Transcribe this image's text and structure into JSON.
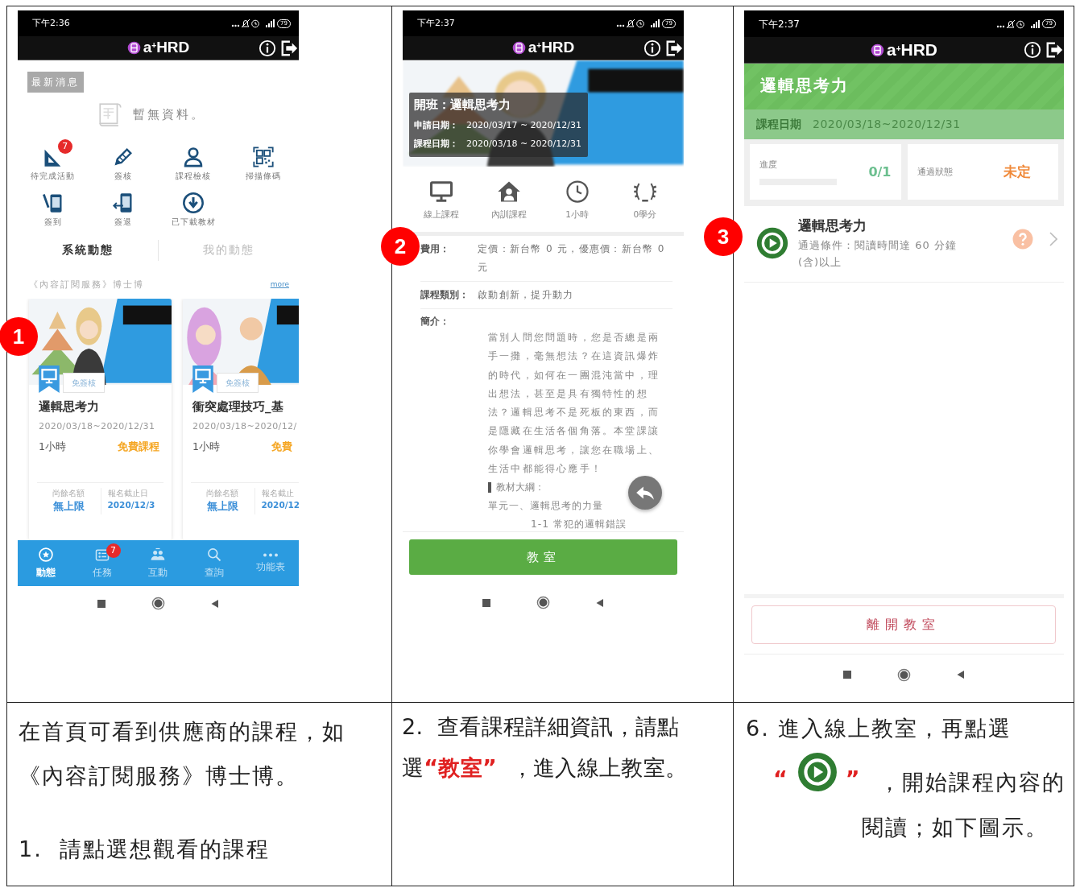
{
  "home_screen": {
    "status_bar": {
      "time": "下午2:36",
      "battery": "79"
    },
    "app_bar": {
      "brand": "a$^{+}$HRD"
    },
    "news_tab": "最新消息",
    "empty_message": "暫無資料。",
    "shortcuts": [
      {
        "label": "待完成活動",
        "badge": "7"
      },
      {
        "label": "簽核"
      },
      {
        "label": "課程檢核"
      },
      {
        "label": "掃描條碼"
      },
      {
        "label": "簽到"
      },
      {
        "label": "簽退"
      },
      {
        "label": "已下載教材"
      }
    ],
    "feed_tabs": [
      {
        "label": "系統動態",
        "selected": true
      },
      {
        "label": "我的動態",
        "selected": false
      }
    ],
    "section": {
      "title": "《內容訂閱服務》博士博",
      "link": "more"
    },
    "courses": [
      {
        "tag": "免簽核",
        "title": "邏輯思考力",
        "dates": "2020/03/18~2020/12/31",
        "duration": "1小時",
        "price": "免費課程",
        "quota_label": "尚餘名額",
        "quota": "無上限",
        "deadline_label": "報名截止日",
        "deadline": "2020/12/3"
      },
      {
        "tag": "免簽核",
        "title": "衝突處理技巧_基",
        "dates": "2020/03/18~2020/12/",
        "duration": "1小時",
        "price": "免費",
        "quota_label": "尚餘名額",
        "quota": "無上限",
        "deadline_label": "報名截止",
        "deadline": "2020/12"
      }
    ],
    "bottom_nav": [
      {
        "label": "動態",
        "selected": true
      },
      {
        "label": "任務",
        "selected": false,
        "badge": "7"
      },
      {
        "label": "互動",
        "selected": false
      },
      {
        "label": "查詢",
        "selected": false
      },
      {
        "label": "功能表",
        "selected": false
      }
    ],
    "step_marker": "1",
    "caption": {
      "paragraph": "在首頁可看到供應商的課程，如《內容訂閱服務》博士博。",
      "step": "1.  請點選想觀看的課程"
    }
  },
  "course_detail_screen": {
    "status_bar": {
      "time": "下午2:37",
      "battery": "79"
    },
    "app_bar": {
      "brand": "a$^{+}$HRD"
    },
    "banner": {
      "title": "開班：邏輯思考力",
      "dates": [
        {
          "label": "申請日期：",
          "value": "2020/03/17 ~ 2020/12/31"
        },
        {
          "label": "課程日期：",
          "value": "2020/03/18 ~ 2020/12/31"
        }
      ]
    },
    "facts": [
      "線上課程",
      "內訓課程",
      "1小時",
      "0學分"
    ],
    "fields": [
      {
        "label": "費用：",
        "value": "定價：新台幣 0 元，優惠價：新台幣 0 元"
      },
      {
        "label": "課程類別：",
        "value": "啟動創新，提升動力"
      }
    ],
    "intro": {
      "label": "簡介：",
      "paragraph": "當別人問您問題時，您是否總是兩手一攤，毫無想法？在這資訊爆炸的時代，如何在一團混沌當中，理出想法，甚至是具有獨特性的想法？邏輯思考不是死板的東西，而是隱藏在生活各個角落。本堂課讓你學會邏輯思考，讓您在職場上、生活中都能得心應手！",
      "outline_label": "教材大綱：",
      "unit": "單元一、邏輯思考的力量",
      "lesson": "1-1 常犯的邏輯錯誤"
    },
    "button": "教室",
    "step_marker": "2",
    "caption": {
      "before": "2.  查看課程詳細資訊，請點選",
      "highlight": "“教室”",
      "after": "  ，進入線上教室。"
    }
  },
  "classroom_screen": {
    "status_bar": {
      "time": "下午2:37",
      "battery": "79"
    },
    "app_bar": {
      "brand": "a$^{+}$HRD"
    },
    "title": "邏輯思考力",
    "date_label": "課程日期",
    "dates": "2020/03/18~2020/12/31",
    "progress": {
      "label": "進度",
      "value": "0/1",
      "level": 0
    },
    "pass_status": {
      "label": "通過狀態",
      "value": "未定"
    },
    "lesson": {
      "title": "邏輯思考力",
      "condition": "通過條件：閱讀時間達 60 分鐘(含)以上"
    },
    "button": "離開教室",
    "step_marker": "3",
    "caption": {
      "lead": "6. 進入線上教室，再點選",
      "quote_open": "“",
      "quote_close": "”",
      "rest": "  ，開始課程內容的閱讀；如下圖示。"
    }
  }
}
